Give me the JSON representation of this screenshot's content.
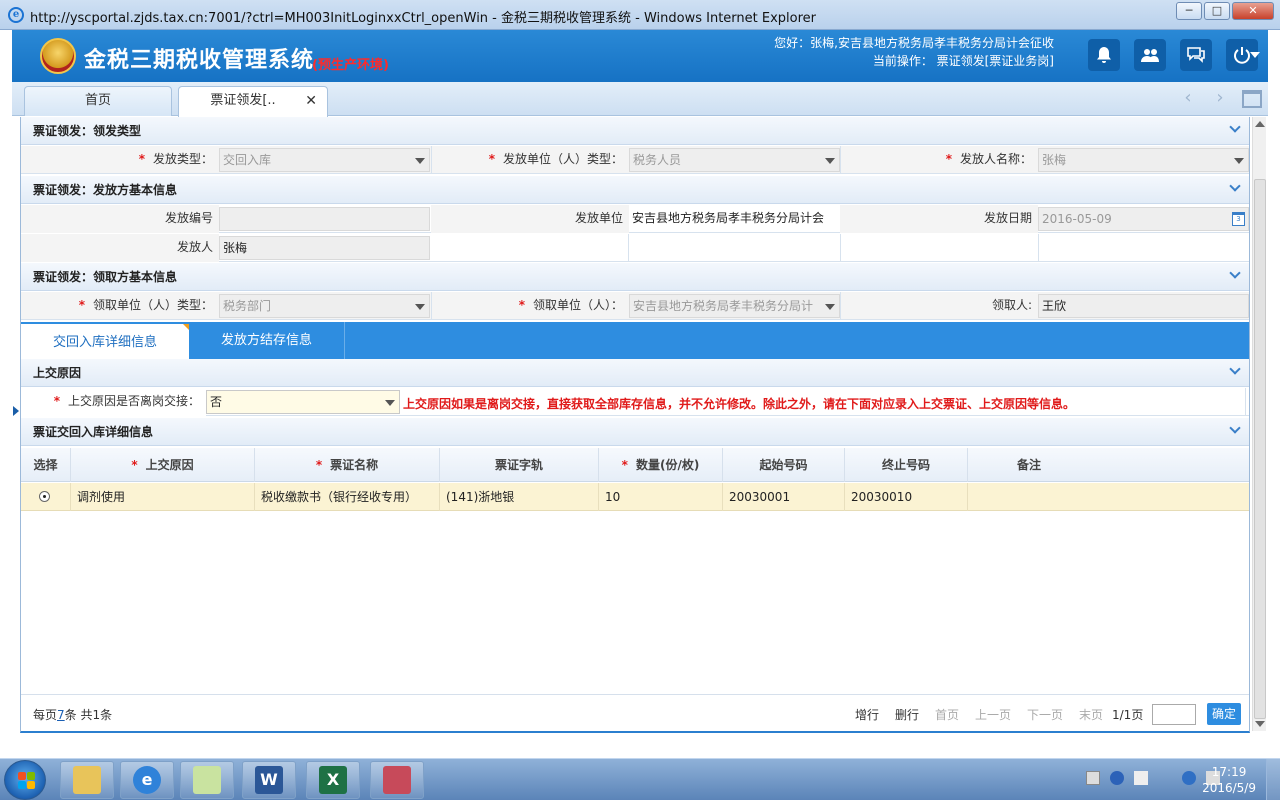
{
  "browser": {
    "title": "http://yscportal.zjds.tax.cn:7001/?ctrl=MH003InitLoginxxCtrl_openWin - 金税三期税收管理系统 - Windows Internet Explorer",
    "minimize": "─",
    "maximize": "□",
    "close": "✕"
  },
  "header": {
    "app_title": "金税三期税收管理系统",
    "env_label": "(预生产环境)",
    "greeting": "您好：张梅,安吉县地方税务局孝丰税务分局计会征收",
    "current_op": "当前操作：  票证领发[票证业务岗]",
    "icons": [
      "bell-icon",
      "users-icon",
      "chat-icon",
      "power-icon"
    ]
  },
  "tabs": {
    "home": "首页",
    "active": "票证领发[..",
    "close": "✕",
    "prev": "‹",
    "next": "›"
  },
  "section_type": {
    "title": "票证领发：领发类型",
    "issue_type_label": "发放类型：",
    "issue_type_value": "交回入库",
    "issuer_unit_type_label": "发放单位（人）类型：",
    "issuer_unit_type_value": "税务人员",
    "issuer_name_label": "发放人名称：",
    "issuer_name_value": "张梅"
  },
  "section_issuer": {
    "title": "票证领发：发放方基本信息",
    "issue_no_label": "发放编号",
    "issue_no_value": "",
    "issue_unit_label": "发放单位",
    "issue_unit_value": "安吉县地方税务局孝丰税务分局计会",
    "issue_date_label": "发放日期",
    "issue_date_value": "2016-05-09",
    "issuer_label": "发放人",
    "issuer_value": "张梅"
  },
  "section_receiver": {
    "title": "票证领发：领取方基本信息",
    "recv_unit_type_label": "领取单位（人）类型：",
    "recv_unit_type_value": "税务部门",
    "recv_unit_label": "领取单位（人）：",
    "recv_unit_value": "安吉县地方税务局孝丰税务分局计",
    "receiver_label": "领取人:",
    "receiver_value": "王欣"
  },
  "inner_tabs": [
    "交回入库详细信息",
    "发放方结存信息"
  ],
  "section_reason": {
    "title": "上交原因",
    "resign_label": "上交原因是否离岗交接：",
    "resign_value": "否",
    "note": "上交原因如果是离岗交接，直接获取全部库存信息，并不允许修改。除此之外，请在下面对应录入上交票证、上交原因等信息。"
  },
  "section_detail": {
    "title": "票证交回入库详细信息",
    "columns": [
      "选择",
      "上交原因",
      "票证名称",
      "票证字轨",
      "数量(份/枚)",
      "起始号码",
      "终止号码",
      "备注"
    ],
    "rows": [
      {
        "reason": "调剂使用",
        "name": "税收缴款书（银行经收专用）",
        "track": "(141)浙地银",
        "qty": "10",
        "start": "20030001",
        "end": "20030010",
        "remark": ""
      }
    ]
  },
  "pager": {
    "per_page_prefix": "每页",
    "per_page_value": "7",
    "per_page_suffix": "条 共1条",
    "add_row": "增行",
    "del_row": "删行",
    "first": "首页",
    "prev": "上一页",
    "next": "下一页",
    "last": "末页",
    "page_info": "1/1页",
    "go": "确定"
  },
  "taskbar": {
    "time": "17:19",
    "date": "2016/5/9"
  }
}
